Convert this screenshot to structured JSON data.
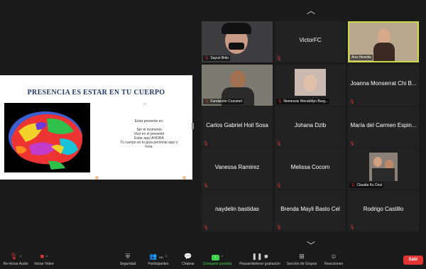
{
  "slide": {
    "title": "PRESENCIA ES ESTAR EN TU CUERPO",
    "intro": "Estar presente es:",
    "lines": [
      "Ser el momento",
      "Vivir en el presente",
      "Estar aquí AHORA",
      "Tu cuerpo es tu guía personal aquí y",
      "hora."
    ]
  },
  "participants": [
    {
      "name": "Sayuri Brito",
      "muted": true
    },
    {
      "name": "VictorFC",
      "muted": true
    },
    {
      "name": "Ana Heredia",
      "muted": false,
      "active": true
    },
    {
      "name": "Fundación Cozumel",
      "muted": true
    },
    {
      "name": "Nemessis Wendollyn Burg...",
      "muted": true
    },
    {
      "name": "Joanna Monserrat Chi B...",
      "muted": true
    },
    {
      "name": "Carlos Gabriel Hoil Sosa",
      "muted": true
    },
    {
      "name": "Johana Dzib",
      "muted": true
    },
    {
      "name": "María del Carmen Espin...",
      "muted": true
    },
    {
      "name": "Vanessa Ramirez",
      "muted": true
    },
    {
      "name": "Melissa Cocom",
      "muted": true
    },
    {
      "name": "Claudia Ku Dzul",
      "muted": true
    },
    {
      "name": "naydelin bastidas",
      "muted": true
    },
    {
      "name": "Brenda Mayli Basto Cel",
      "muted": true
    },
    {
      "name": "Rodrigo Castillo",
      "muted": true
    }
  ],
  "toolbar": {
    "unmute": "Re-iniciar Audio",
    "video": "Iniciar Video",
    "security": "Seguridad",
    "participants": "Participantes",
    "participants_count": "181",
    "chat": "Chatear",
    "share": "Compartir pantalla",
    "record": "Pausar/detener grabación",
    "breakout": "Sección de Grupos",
    "reactions": "Reacciones",
    "leave": "Salir"
  },
  "colors": {
    "accent_green": "#3fd14a",
    "leave_red": "#e03535",
    "active_border": "#c9d94a",
    "slide_title": "#1f3a6b"
  }
}
